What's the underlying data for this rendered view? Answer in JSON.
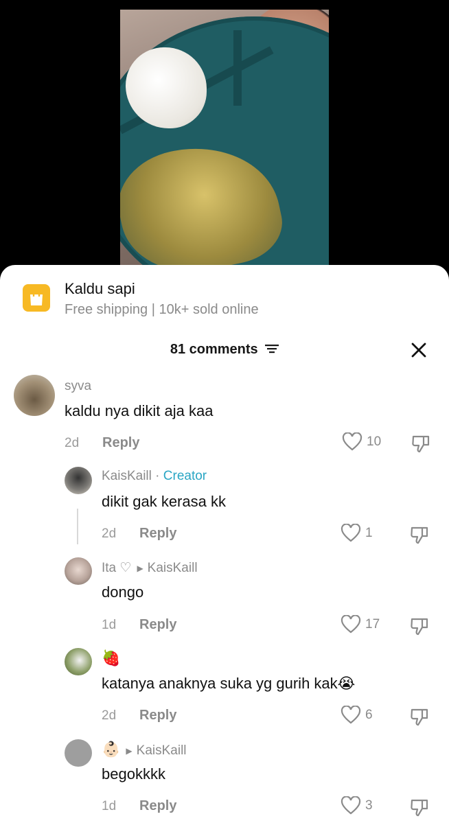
{
  "product": {
    "name": "Kaldu sapi",
    "subtitle": "Free shipping | 10k+ sold online",
    "icon": "shopping-bag-icon"
  },
  "comments_header": {
    "count_label": "81 comments"
  },
  "comments": [
    {
      "user": "syva",
      "tag": "",
      "reply_to": "",
      "text": "kaldu nya dikit aja kaa",
      "time": "2d",
      "reply_label": "Reply",
      "likes": "10"
    },
    {
      "user": "KaisKaill",
      "tag": "Creator",
      "separator": " · ",
      "reply_to": "",
      "text": "dikit gak kerasa kk",
      "time": "2d",
      "reply_label": "Reply",
      "likes": "1"
    },
    {
      "user": "Ita ♡",
      "tag": "",
      "reply_to": "KaisKaill",
      "text": "dongo",
      "time": "1d",
      "reply_label": "Reply",
      "likes": "17"
    },
    {
      "user": "🍓",
      "tag": "",
      "reply_to": "",
      "text": "katanya anaknya suka yg gurih kak😭",
      "time": "2d",
      "reply_label": "Reply",
      "likes": "6"
    },
    {
      "user": "👶🏻",
      "tag": "",
      "reply_to": "KaisKaill",
      "text": "begokkkk",
      "time": "1d",
      "reply_label": "Reply",
      "likes": "3"
    }
  ],
  "colors": {
    "accent_creator": "#2aa6c4",
    "bag_icon": "#f7b924"
  }
}
